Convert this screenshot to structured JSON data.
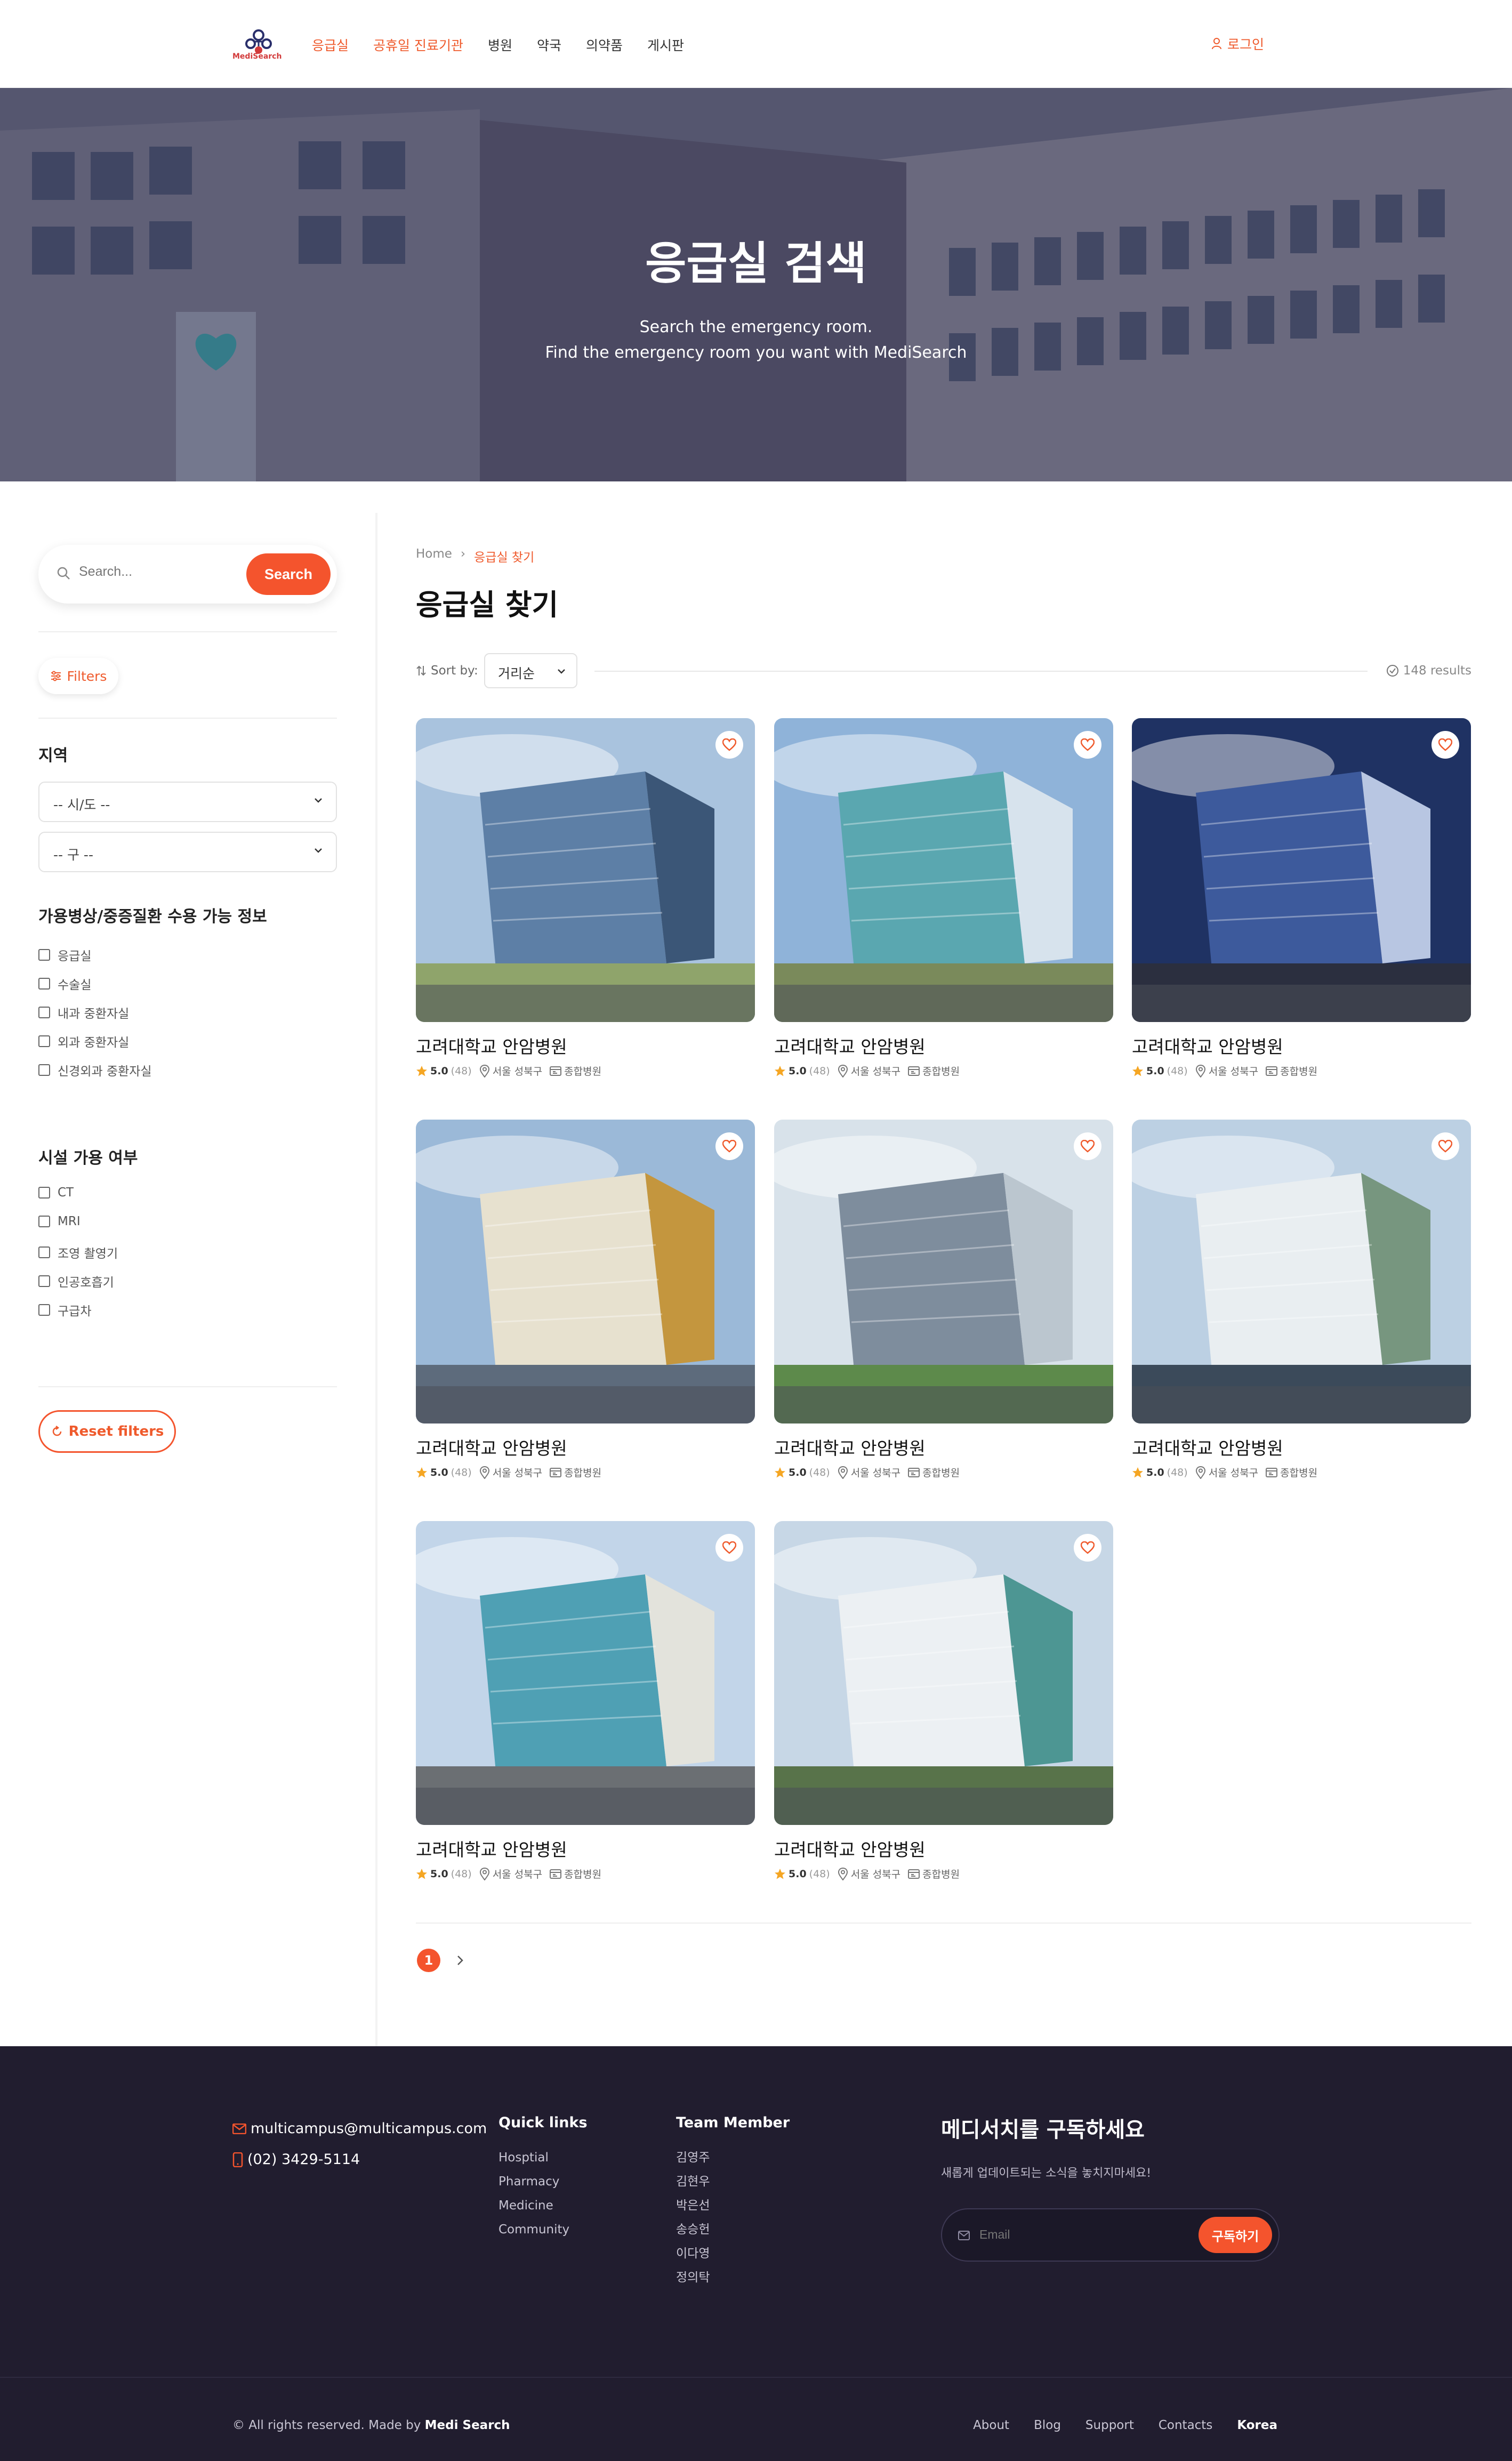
{
  "header": {
    "logo_text": "MediSearch",
    "nav": [
      "응급실",
      "공휴일 진료기관",
      "병원",
      "약국",
      "의약품",
      "게시판"
    ],
    "active_nav": 0,
    "login": "로그인"
  },
  "hero": {
    "title": "응급실 검색",
    "subtitle_line1": "Search the emergency room.",
    "subtitle_line2": "Find the emergency room you want with MediSearch"
  },
  "sidebar": {
    "search_placeholder": "Search...",
    "search_button": "Search",
    "filters_label": "Filters",
    "region_title": "지역",
    "region_select_1": "-- 시/도 --",
    "region_select_2": "-- 구 --",
    "beds_title": "가용병상/중증질환 수용 가능 정보",
    "beds_options": [
      "응급실",
      "수술실",
      "내과 중환자실",
      "외과 중환자실",
      "신경외과 중환자실"
    ],
    "facility_title": "시설 가용 여부",
    "facility_options": [
      "CT",
      "MRI",
      "조영 촬영기",
      "인공호흡기",
      "구급차"
    ],
    "reset_label": "Reset filters"
  },
  "main": {
    "breadcrumb_home": "Home",
    "breadcrumb_current": "응급실 찾기",
    "title": "응급실 찾기",
    "sort_label": "Sort by:",
    "sort_value": "거리순",
    "results": "148 results",
    "cards": [
      {
        "name": "고려대학교 안암병원",
        "rating": "5.0",
        "count": "(48)",
        "location": "서울 성북구",
        "type": "종합병원"
      },
      {
        "name": "고려대학교 안암병원",
        "rating": "5.0",
        "count": "(48)",
        "location": "서울 성북구",
        "type": "종합병원"
      },
      {
        "name": "고려대학교 안암병원",
        "rating": "5.0",
        "count": "(48)",
        "location": "서울 성북구",
        "type": "종합병원"
      },
      {
        "name": "고려대학교 안암병원",
        "rating": "5.0",
        "count": "(48)",
        "location": "서울 성북구",
        "type": "종합병원"
      },
      {
        "name": "고려대학교 안암병원",
        "rating": "5.0",
        "count": "(48)",
        "location": "서울 성북구",
        "type": "종합병원"
      },
      {
        "name": "고려대학교 안암병원",
        "rating": "5.0",
        "count": "(48)",
        "location": "서울 성북구",
        "type": "종합병원"
      },
      {
        "name": "고려대학교 안암병원",
        "rating": "5.0",
        "count": "(48)",
        "location": "서울 성북구",
        "type": "종합병원"
      },
      {
        "name": "고려대학교 안암병원",
        "rating": "5.0",
        "count": "(48)",
        "location": "서울 성북구",
        "type": "종합병원"
      }
    ],
    "page_current": "1"
  },
  "footer": {
    "email": "multicampus@multicampus.com",
    "phone": "(02) 3429-5114",
    "quick_links_title": "Quick links",
    "quick_links": [
      "Hosptial",
      "Pharmacy",
      "Medicine",
      "Community"
    ],
    "team_title": "Team Member",
    "team": [
      "김영주",
      "김현우",
      "박은선",
      "송승헌",
      "이다영",
      "정의탁"
    ],
    "subscribe_title": "메디서치를 구독하세요",
    "subscribe_desc": "새롭게 업데이트되는 소식을 놓치지마세요!",
    "email_placeholder": "Email",
    "subscribe_button": "구독하기",
    "copyright_prefix": "© All rights reserved. Made by",
    "copyright_brand": "Medi Search",
    "bottom_links": [
      "About",
      "Blog",
      "Support",
      "Contacts"
    ],
    "country": "Korea"
  },
  "colors": {
    "accent": "#f4542d",
    "footer_bg": "#211d2f"
  }
}
